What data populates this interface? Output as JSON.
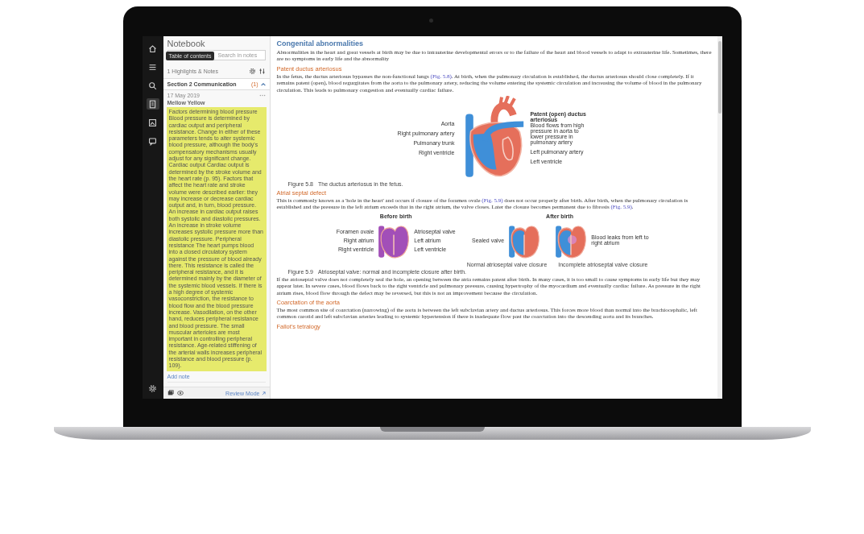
{
  "rail": {
    "items": [
      {
        "selected": false
      },
      {
        "selected": false
      },
      {
        "selected": false
      },
      {
        "selected": true
      },
      {
        "selected": false
      },
      {
        "selected": false
      }
    ],
    "tooltip": "Table of contents"
  },
  "notebook": {
    "title": "Notebook",
    "search": {
      "placeholder": "Search in notes"
    },
    "count": "1 Highlights & Notes",
    "section": {
      "title": "Section 2 Communication",
      "count": "(1)",
      "expanded": true
    },
    "note": {
      "date": "17 May 2019",
      "color_name": "Mellow Yellow",
      "text": "Factors determining blood pressure Blood pressure is determined by cardiac output and peripheral resistance. Change in either of these parameters tends to alter systemic blood pressure, although the body's compensatory mechanisms usually adjust for any significant change. Cardiac output Cardiac output is determined by the stroke volume and the heart rate (p. 95). Factors that affect the heart rate and stroke volume were described earlier: they may increase or decrease cardiac output and, in turn, blood pressure. An increase in cardiac output raises both systolic and diastolic pressures. An increase in stroke volume increases systolic pressure more than diastolic pressure. Peripheral resistance The heart pumps blood into a closed circulatory system against the pressure of blood already there. This resistance is called the peripheral resistance, and it is determined mainly by the diameter of the systemic blood vessels. If there is a high degree of systemic vasoconstriction, the resistance to blood flow and the blood pressure increase. Vasodilation, on the other hand, reduces peripheral resistance and blood pressure. The small muscular arterioles are most important in controlling peripheral resistance. Age-related stiffening of the arterial walls increases peripheral resistance and blood pressure (p. 109)."
    },
    "add_note": "Add note",
    "review_mode": "Review Mode"
  },
  "article": [
    {
      "kind": "heading",
      "text": "Congenital abnormalities"
    },
    {
      "kind": "paragraph",
      "parts": [
        {
          "kind": "text",
          "text": "Abnormalities in the heart and great vessels at birth may be due to intrauterine developmental errors or to the failure of the heart and blood vessels to adapt to extrauterine life. Sometimes, there are no symptoms in early life and the abnormality"
        }
      ]
    },
    {
      "kind": "subheading",
      "text": "Patent ductus arteriosus"
    },
    {
      "kind": "paragraph",
      "parts": [
        {
          "kind": "text",
          "text": "In the fetus, the ductus arteriosus bypasses the non-functional lungs "
        },
        {
          "kind": "link",
          "text": "(Fig. 5.8)"
        },
        {
          "kind": "text",
          "text": ". At birth, when the pulmonary circulation is established, the ductus arteriosus should close completely. If it remains patent (open), blood regurgitates from the aorta to the pulmonary artery, reducing the volume entering the systemic circulation and increasing the volume of blood in the pulmonary circulation. This leads to pulmonary congestion and eventually cardiac failure."
        }
      ]
    },
    {
      "kind": "figure_heart",
      "labels_left": [
        "Aorta",
        "Right pulmonary artery",
        "Pulmonary trunk",
        "Right ventricle"
      ],
      "label_title": "Patent (open) ductus arteriosus",
      "label_note": "Blood flows from high pressure in aorta to lower pressure in pulmonary artery",
      "labels_right": [
        "Left pulmonary artery",
        "Left ventricle"
      ],
      "caption_number": "Figure 5.8",
      "caption": "The ductus arteriosus in the fetus."
    },
    {
      "kind": "subheading",
      "text": "Atrial septal defect"
    },
    {
      "kind": "paragraph",
      "parts": [
        {
          "kind": "text",
          "text": "This is commonly known as a 'hole in the heart' and occurs if closure of the foramen ovale "
        },
        {
          "kind": "link",
          "text": "(Fig. 5.9)"
        },
        {
          "kind": "text",
          "text": " does not occur properly after birth. After birth, when the pulmonary circulation is established and the pressure in the left atrium exceeds that in the right atrium, the valve closes. Later the closure becomes permanent due to fibrosis "
        },
        {
          "kind": "link",
          "text": "(Fig. 5.9)"
        },
        {
          "kind": "text",
          "text": "."
        }
      ]
    },
    {
      "kind": "figure_panels",
      "groups": [
        {
          "title": "Before birth",
          "panels": [
            {
              "kind": "fetal",
              "labels_left": [
                "Foramen ovale",
                "Right atrium",
                "Right ventricle"
              ],
              "labels_right": [
                "Atrioseptal valve",
                "Left atrium",
                "Left ventricle"
              ]
            }
          ]
        },
        {
          "title": "After birth",
          "panels": [
            {
              "kind": "normal",
              "labels_left": [
                "Sealed valve"
              ],
              "caption": "Normal atrioseptal valve closure"
            },
            {
              "kind": "incomplete",
              "labels_right": [
                "Blood leaks from left to right atrium"
              ],
              "caption": "Incomplete atrioseptal valve closure"
            }
          ]
        }
      ],
      "caption_number": "Figure 5.9",
      "caption": "Atrioseptal valve: normal and incomplete closure after birth."
    },
    {
      "kind": "paragraph",
      "parts": [
        {
          "kind": "text",
          "text": "If the atrioseptal valve does not completely seal the hole, an opening between the atria remains patent after birth. In many cases, it is too small to cause symptoms in early life but they may appear later. In severe cases, blood flows back to the right ventricle and pulmonary pressure, causing hypertrophy of the myocardium and eventually cardiac failure. As pressure in the right atrium rises, blood flow through the defect may be reversed, but this is not an improvement because the circulation."
        }
      ]
    },
    {
      "kind": "subheading",
      "text": "Coarctation of the aorta"
    },
    {
      "kind": "paragraph",
      "parts": [
        {
          "kind": "text",
          "text": "The most common site of coarctation (narrowing) of the aorta is between the left subclavian artery and ductus arteriosus. This forces more blood than normal into the brachiocephalic, left common carotid and left subclavian arteries leading to systemic hypertension if there is inadequate flow past the coarctation into the descending aorta and its branches."
        }
      ]
    },
    {
      "kind": "subheading",
      "text": "Fallot's tetralogy"
    }
  ]
}
